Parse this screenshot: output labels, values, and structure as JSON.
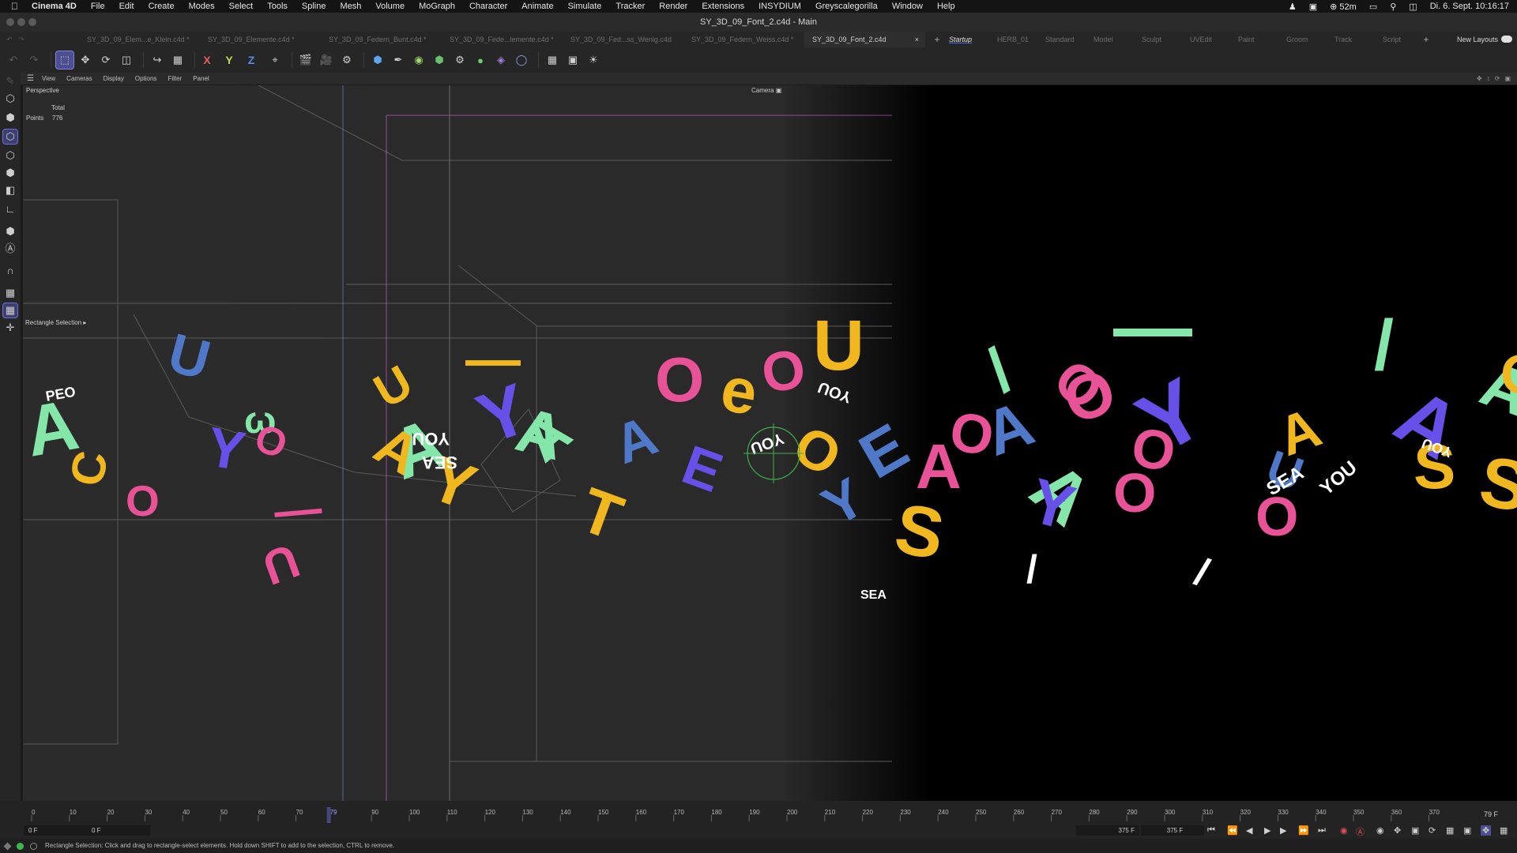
{
  "menubar": {
    "app": "Cinema 4D",
    "items": [
      "File",
      "Edit",
      "Create",
      "Modes",
      "Select",
      "Tools",
      "Spline",
      "Mesh",
      "Volume",
      "MoGraph",
      "Character",
      "Animate",
      "Simulate",
      "Tracker",
      "Render",
      "Extensions",
      "INSYDIUM",
      "Greyscalegorilla",
      "Window",
      "Help"
    ],
    "battery": "52m",
    "datetime": "Di. 6. Sept.  10:16:17"
  },
  "window": {
    "title": "SY_3D_09_Font_2.c4d - Main"
  },
  "tabs": {
    "files": [
      "SY_3D_09_Elem...e_Klein.c4d *",
      "SY_3D_09_Elemente.c4d *",
      "SY_3D_09_Federn_Bunt.c4d *",
      "SY_3D_09_Fede...lemente.c4d *",
      "SY_3D_09_Fed...ss_Wenig.c4d",
      "SY_3D_09_Federn_Weiss.c4d *",
      "SY_3D_09_Font_2.c4d"
    ],
    "active_close": "×",
    "plus": "+",
    "layouts": [
      "Startup",
      "HERB_01",
      "Standard",
      "Model",
      "Sculpt",
      "UVEdit",
      "Paint",
      "Groom",
      "Track",
      "Script"
    ],
    "new_layouts": "New Layouts"
  },
  "toolbar": {
    "axes": {
      "x": "X",
      "y": "Y",
      "z": "Z"
    },
    "axis_colors": {
      "x": "#e0605a",
      "y": "#b9d84a",
      "z": "#5a8ae6"
    }
  },
  "viewport": {
    "menu": [
      "View",
      "Cameras",
      "Display",
      "Options",
      "Filter",
      "Panel"
    ],
    "name": "Perspective",
    "camera": "Camera",
    "stats_header": "Total",
    "stats_label": "Points",
    "stats_value": "776",
    "tool_label": "Rectangle Selection"
  },
  "timeline": {
    "ticks": [
      "0",
      "10",
      "20",
      "30",
      "40",
      "50",
      "60",
      "70",
      "79",
      "90",
      "100",
      "110",
      "120",
      "130",
      "140",
      "150",
      "160",
      "170",
      "180",
      "190",
      "200",
      "210",
      "220",
      "230",
      "240",
      "250",
      "260",
      "270",
      "280",
      "290",
      "300",
      "310",
      "320",
      "330",
      "340",
      "350",
      "360",
      "370"
    ],
    "current_frame": 79,
    "current_frame_label": "79 F",
    "start_field": "0 F",
    "preview_start": "0 F",
    "end_field": "375 F",
    "preview_end": "375 F"
  },
  "status": {
    "message": "Rectangle Selection: Click and drag to rectangle-select elements. Hold down SHIFT to add to the selection, CTRL to remove."
  },
  "colors": {
    "yellow": "#f0b81e",
    "pink": "#e85296",
    "mint": "#84e6a8",
    "violet": "#6650e8",
    "blue": "#4f79c8",
    "white": "#ffffff",
    "selection": "#4c4f8f"
  }
}
